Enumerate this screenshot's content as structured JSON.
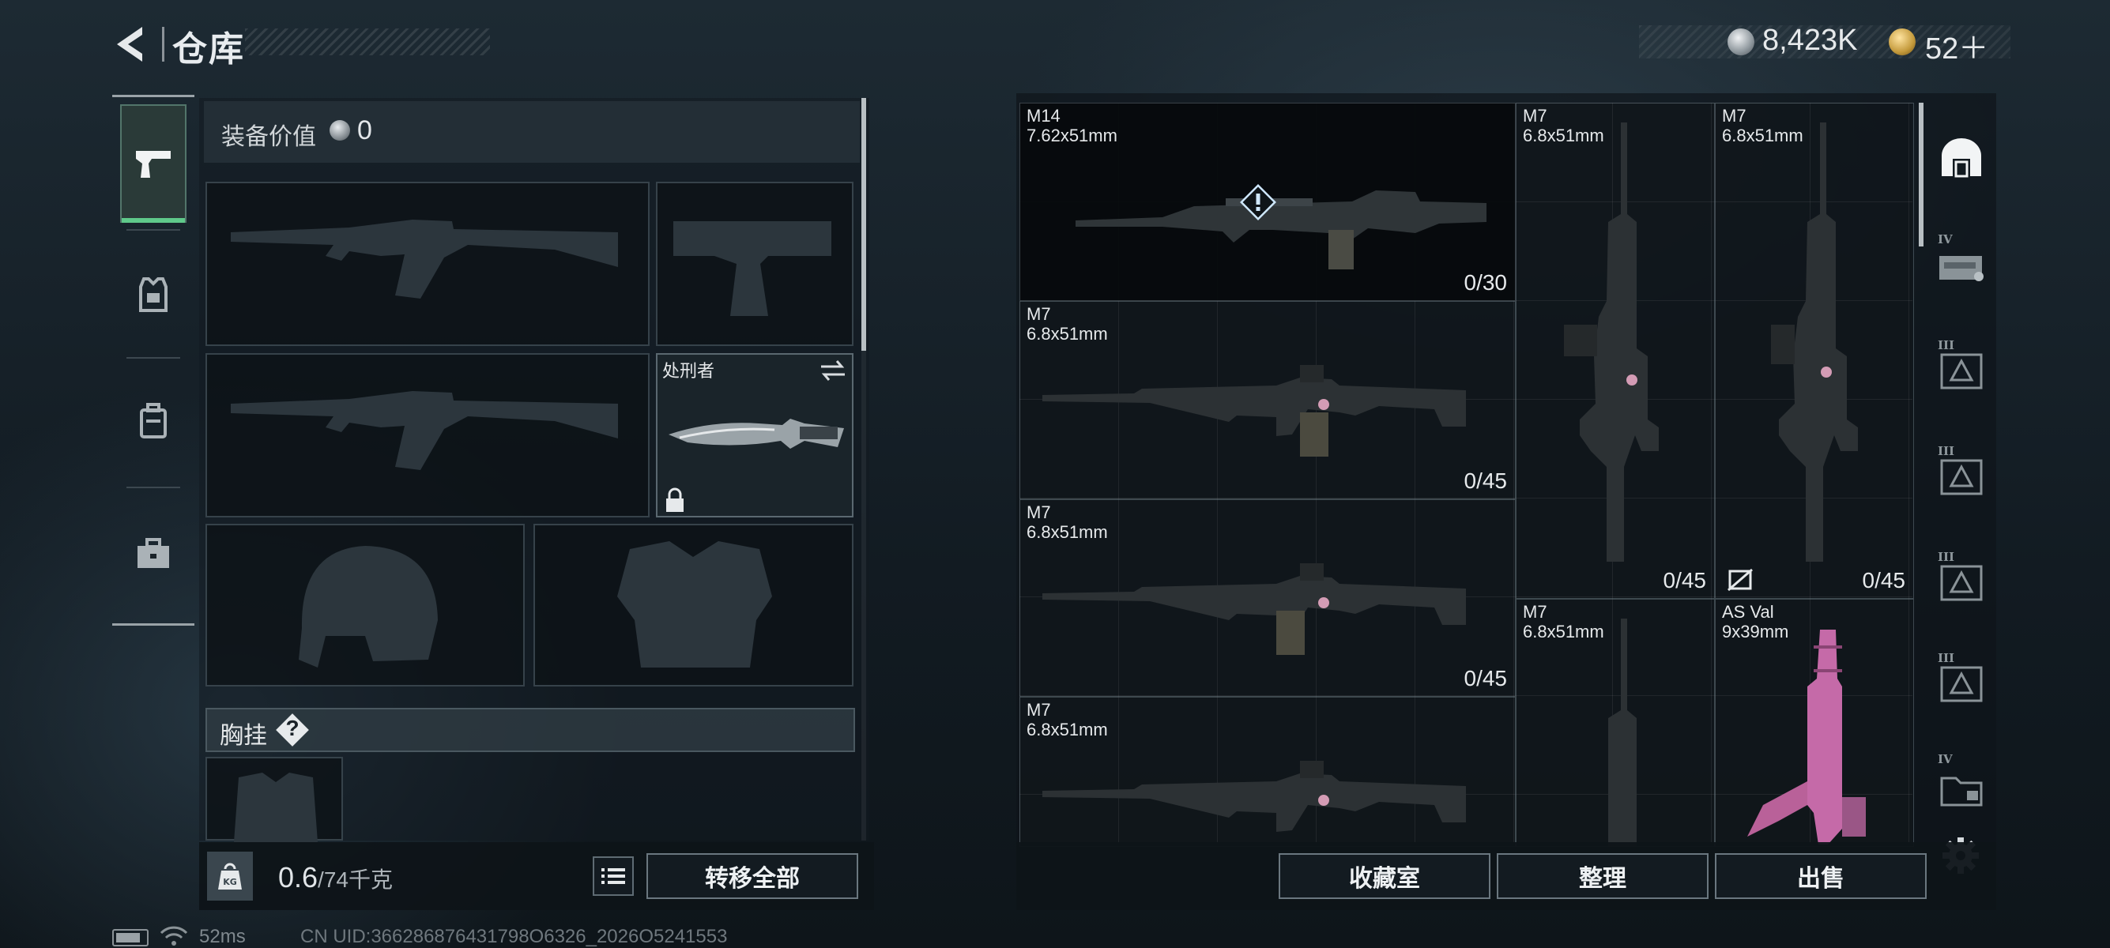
{
  "header": {
    "title": "仓库",
    "currency": {
      "silver": "8,423K",
      "gold": "52＋"
    }
  },
  "left_tabs": [
    "weapons",
    "armor",
    "backpack",
    "case"
  ],
  "loadout": {
    "equip_value_label": "装备价值",
    "equip_value": "0",
    "melee_name": "处刑者",
    "chest_rig_label": "胸挂",
    "chest_rig_help": "?",
    "weight_current": "0.6",
    "weight_max": "/74千克",
    "transfer_all": "转移全部"
  },
  "stash": {
    "items": [
      {
        "name": "M14",
        "caliber": "7.62x51mm",
        "ammo": "0/30"
      },
      {
        "name": "M7",
        "caliber": "6.8x51mm",
        "ammo": "0/45"
      },
      {
        "name": "M7",
        "caliber": "6.8x51mm",
        "ammo": "0/45"
      },
      {
        "name": "M7",
        "caliber": "6.8x51mm",
        "ammo": ""
      },
      {
        "name": "M7",
        "caliber": "6.8x51mm",
        "ammo": "0/45"
      },
      {
        "name": "M7",
        "caliber": "6.8x51mm",
        "ammo": "0/45"
      },
      {
        "name": "M7",
        "caliber": "6.8x51mm",
        "ammo": ""
      },
      {
        "name": "AS Val",
        "caliber": "9x39mm",
        "ammo": ""
      }
    ],
    "categories": [
      {
        "icon": "all-items-icon",
        "tier": ""
      },
      {
        "icon": "weapon-case-icon",
        "tier": "IV"
      },
      {
        "icon": "ammo-box-icon",
        "tier": "III"
      },
      {
        "icon": "ammo-box-icon",
        "tier": "III"
      },
      {
        "icon": "ammo-box-icon",
        "tier": "III"
      },
      {
        "icon": "ammo-box-icon",
        "tier": "III"
      },
      {
        "icon": "folder-case-icon",
        "tier": "IV"
      }
    ]
  },
  "actions": {
    "collection": "收藏室",
    "sort": "整理",
    "sell": "出售"
  },
  "status": {
    "ping": "52ms",
    "uid": "CN UID:366286876431798O6326_2026O5241553"
  },
  "colors": {
    "accent_green": "#5fc98a",
    "panel_bg": "#121a20",
    "text_primary": "#e6e9eb"
  }
}
